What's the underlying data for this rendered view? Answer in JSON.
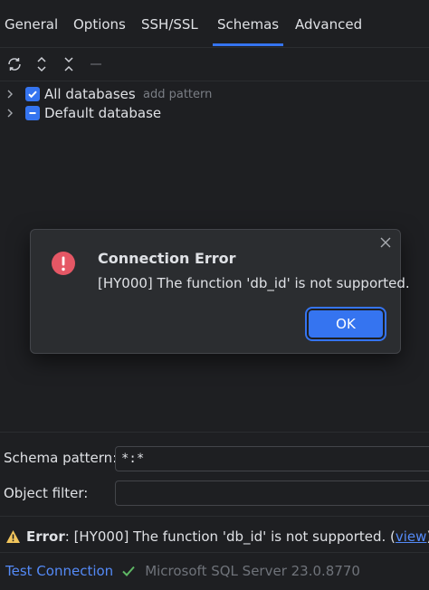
{
  "tabs": [
    {
      "label": "General"
    },
    {
      "label": "Options"
    },
    {
      "label": "SSH/SSL"
    },
    {
      "label": "Schemas",
      "active": true
    },
    {
      "label": "Advanced"
    }
  ],
  "tree": {
    "rows": [
      {
        "label": "All databases",
        "hint": "add pattern",
        "checked": true
      },
      {
        "label": "Default database",
        "checked": "partial"
      }
    ]
  },
  "dialog": {
    "title": "Connection Error",
    "message": "[HY000] The function 'db_id' is not supported.",
    "ok_label": "OK"
  },
  "form": {
    "schema_pattern_label": "Schema pattern:",
    "schema_pattern_value": "*:*",
    "object_filter_label": "Object filter:",
    "object_filter_value": ""
  },
  "status": {
    "error_label": "Error",
    "message_prefix": ": [HY000] The function 'db_id' is not supported. (",
    "link_text": "view",
    "message_suffix": ")"
  },
  "footer": {
    "test_connection_label": "Test Connection",
    "server_version": "Microsoft SQL Server 23.0.8770"
  },
  "colors": {
    "accent": "#3574f0",
    "error": "#e55765",
    "warning": "#f2c55c",
    "success": "#5fb865",
    "link": "#548af7"
  }
}
